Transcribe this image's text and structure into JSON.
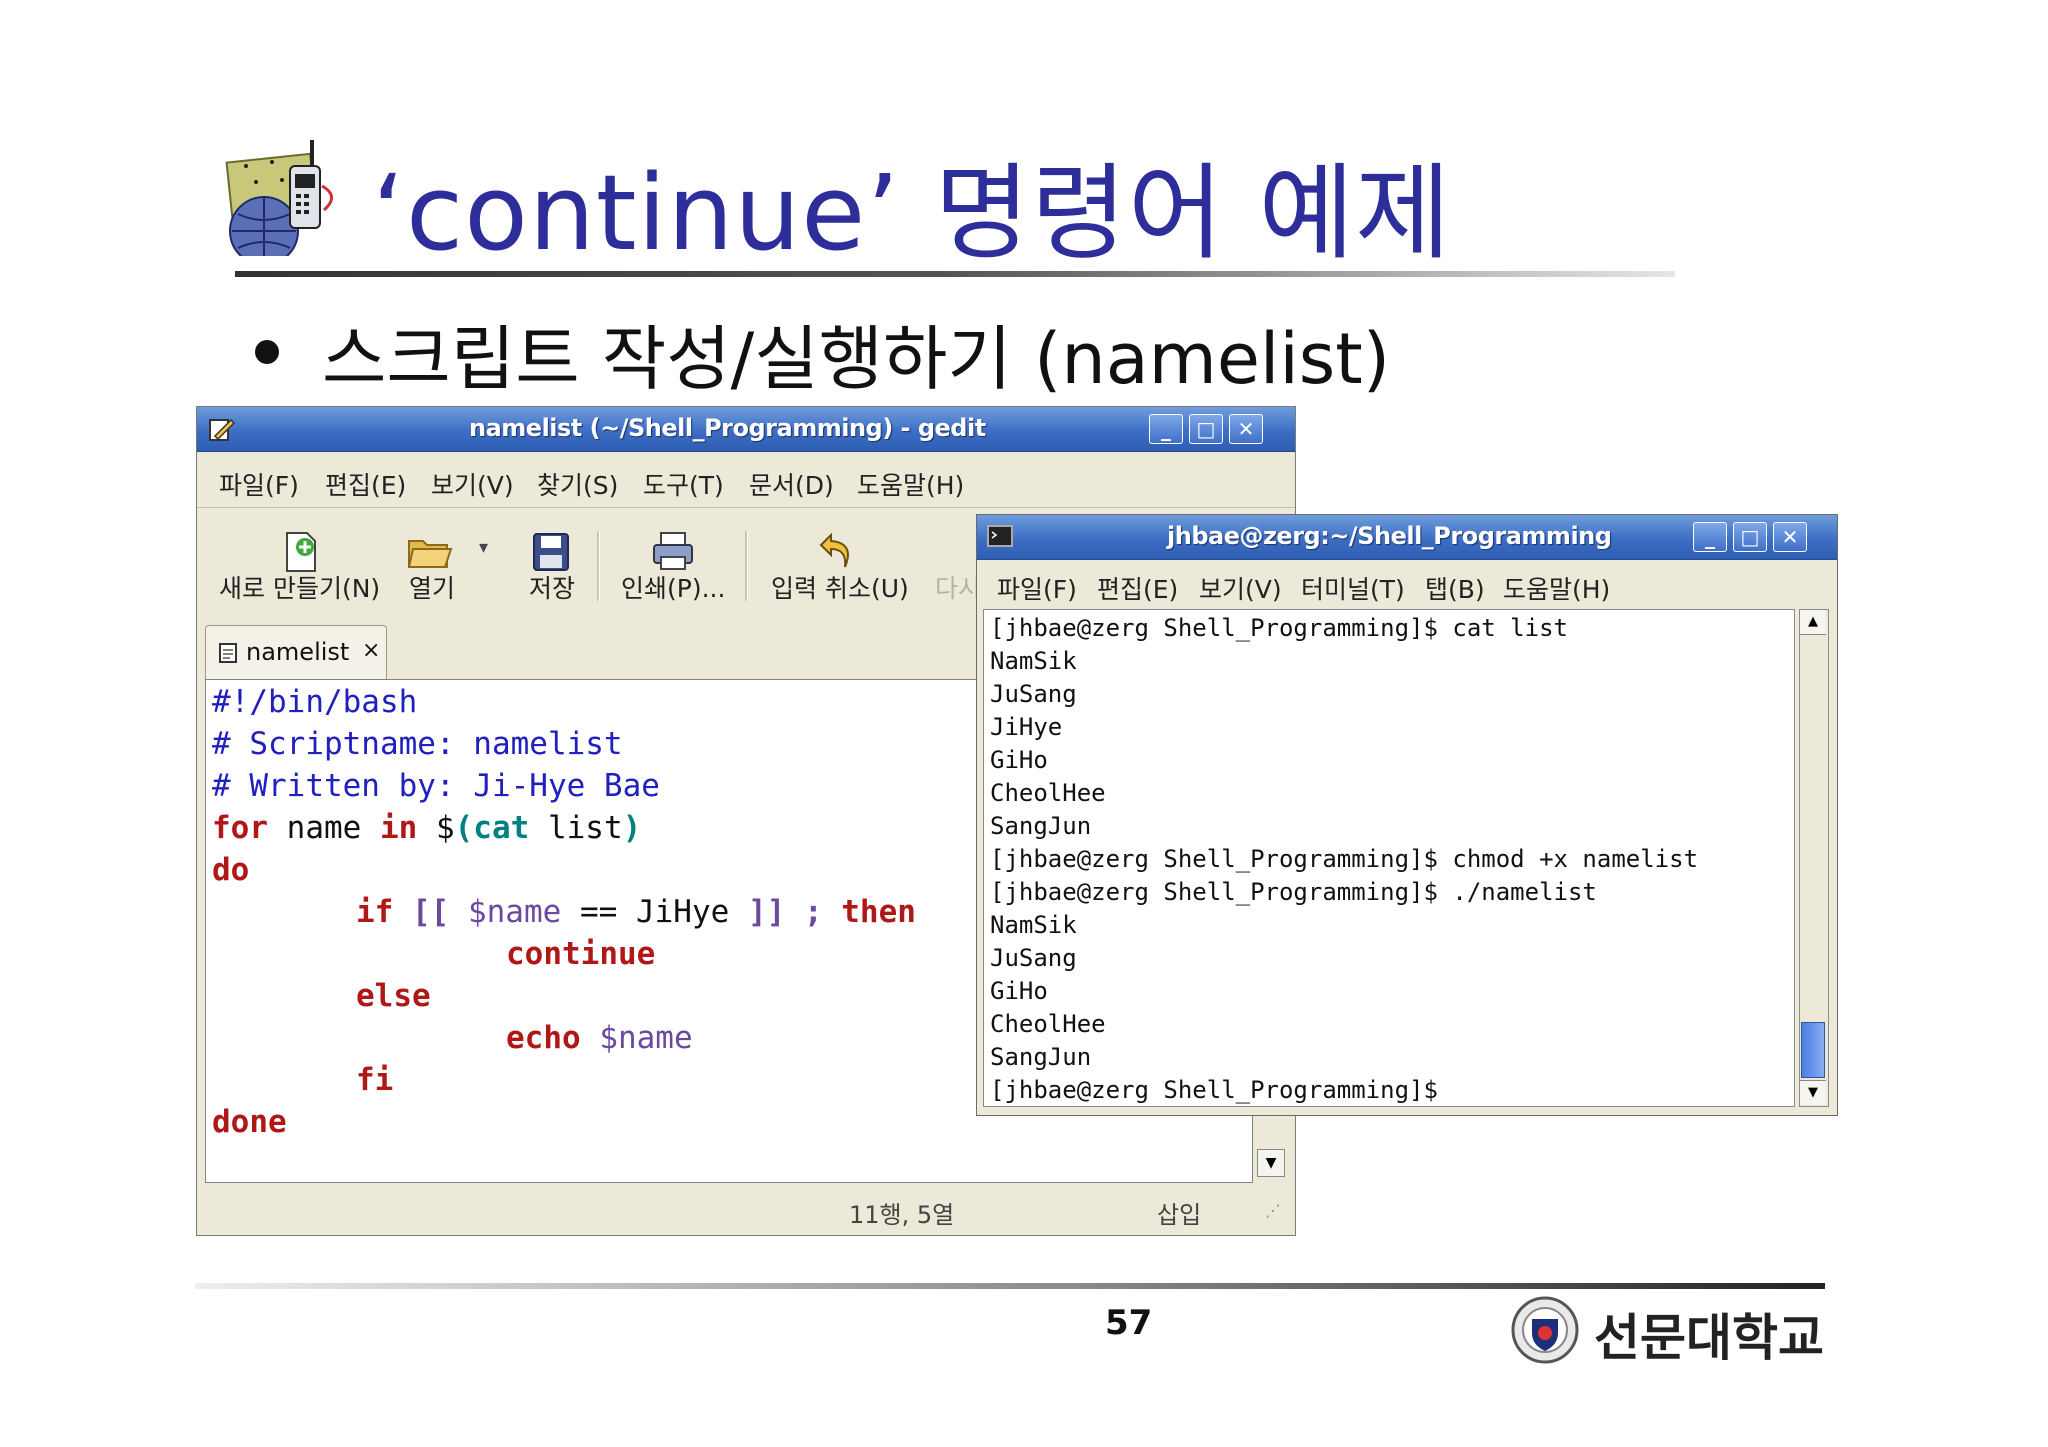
{
  "slide": {
    "title": "‘continue’ 명령어 예제",
    "bullet": "스크립트 작성/실행하기 (namelist)",
    "page_number": "57",
    "university": "선문대학교"
  },
  "gedit": {
    "title": "namelist (~/Shell_Programming) - gedit",
    "menu": [
      "파일(F)",
      "편집(E)",
      "보기(V)",
      "찾기(S)",
      "도구(T)",
      "문서(D)",
      "도움말(H)"
    ],
    "toolbar": {
      "new": "새로 만들기(N)",
      "open": "열기",
      "save": "저장",
      "print": "인쇄(P)...",
      "undo": "입력 취소(U)",
      "redo": "다시"
    },
    "tab": {
      "label": "namelist",
      "close": "×"
    },
    "code": {
      "l1": "#!/bin/bash",
      "l2": "# Scriptname: namelist",
      "l3": "# Written by: Ji-Hye Bae",
      "l4_kw1": "for",
      "l4_t1": " name ",
      "l4_kw2": "in",
      "l4_t2": " $",
      "l4_t3": "(cat",
      "l4_t4": " list",
      "l4_t5": ")",
      "l5": "do",
      "l6_kw1": "if",
      "l6_t1": " [[ ",
      "l6_var": "$name",
      "l6_t2": " == JiHye ",
      "l6_t3": "]] ;",
      "l6_kw2": " then",
      "l7": "continue",
      "l8": "else",
      "l9_kw": "echo",
      "l9_var": " $name",
      "l10": "fi",
      "l11": "done"
    },
    "status": {
      "position": "11행, 5열",
      "mode": "삽입"
    }
  },
  "terminal": {
    "title": "jhbae@zerg:~/Shell_Programming",
    "menu": [
      "파일(F)",
      "편집(E)",
      "보기(V)",
      "터미널(T)",
      "탭(B)",
      "도움말(H)"
    ],
    "lines": [
      "[jhbae@zerg Shell_Programming]$ cat list",
      "NamSik",
      "JuSang",
      "JiHye",
      "GiHo",
      "CheolHee",
      "SangJun",
      "[jhbae@zerg Shell_Programming]$ chmod +x namelist",
      "[jhbae@zerg Shell_Programming]$ ./namelist",
      "NamSik",
      "JuSang",
      "GiHo",
      "CheolHee",
      "SangJun",
      "[jhbae@zerg Shell_Programming]$"
    ]
  }
}
